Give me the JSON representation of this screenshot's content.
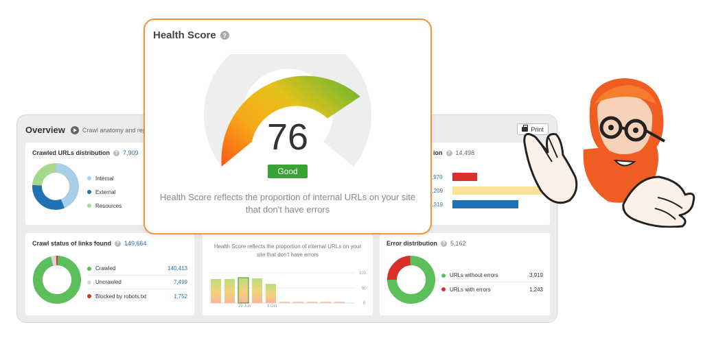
{
  "overview": {
    "title": "Overview",
    "subtitle": "Crawl anatomy and repo",
    "print_label": "Print"
  },
  "crawled_urls": {
    "title": "Crawled URLs distribution",
    "count": "7,909",
    "legend": [
      {
        "label": "Internal",
        "color": "#a8cfe6"
      },
      {
        "label": "External",
        "color": "#2271b3"
      },
      {
        "label": "Resources",
        "color": "#a8d98a"
      }
    ]
  },
  "right_top": {
    "title_fragment": "ion",
    "count": "14,498",
    "rows": [
      {
        "value": ",970",
        "color": "#d9302c",
        "fraction": 0.27
      },
      {
        "value": "7,209",
        "color": "#fde39a",
        "fraction": 1.0
      },
      {
        "value": "5,319",
        "color": "#2271b3",
        "fraction": 0.74
      }
    ]
  },
  "crawl_status": {
    "title": "Crawl status of links found",
    "count": "149,664",
    "rows": [
      {
        "label": "Crawled",
        "value": "140,413",
        "color": "#5cbf5c"
      },
      {
        "label": "Uncrawled",
        "value": "7,499",
        "color": "#d6d6d6"
      },
      {
        "label": "Blocked by robots.txt",
        "value": "1,752",
        "color": "#d9302c"
      }
    ]
  },
  "mini_chart": {
    "note": "Health Score reflects the proportion of internal URLs on your site that don't have errors",
    "y_ticks": [
      "100",
      "50",
      "0"
    ],
    "x_labels": [
      "29 Jun",
      "9 Oct"
    ]
  },
  "error_distribution": {
    "title": "Error distribution",
    "count": "5,162",
    "rows": [
      {
        "label": "URLs without errors",
        "value": "3,919",
        "color": "#5cbf5c"
      },
      {
        "label": "URLs with errors",
        "value": "1,243",
        "color": "#d9302c"
      }
    ]
  },
  "health_score": {
    "title": "Health Score",
    "help": "?",
    "score": "76",
    "score_value": 76,
    "status": "Good",
    "status_color": "#3aa335",
    "description": "Health Score reflects the proportion of internal URLs on your site that don't have errors"
  },
  "colors": {
    "accent_border": "#f59332",
    "good_green": "#3aa335",
    "link_blue": "#2b6cb0"
  }
}
